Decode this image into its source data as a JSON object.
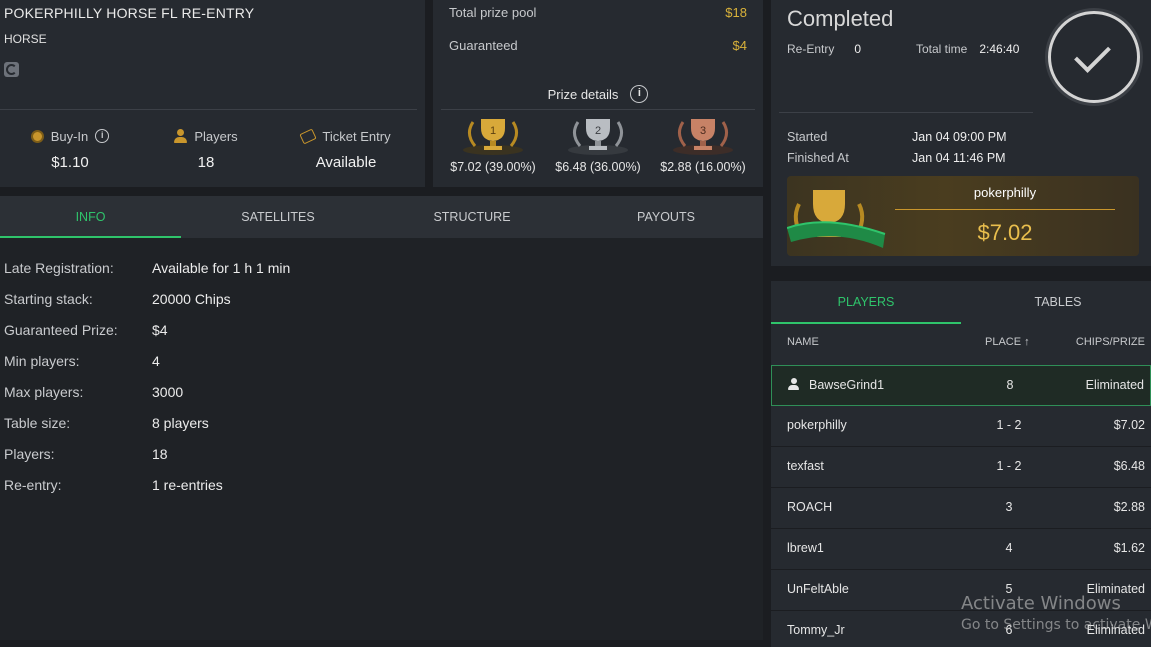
{
  "tournament": {
    "name": "POKERPHILLY HORSE FL RE-ENTRY",
    "game": "HORSE",
    "stats": [
      {
        "label": "Buy-In",
        "value": "$1.10"
      },
      {
        "label": "Players",
        "value": "18"
      },
      {
        "label": "Ticket Entry",
        "value": "Available"
      }
    ]
  },
  "prize": {
    "pool_label": "Total prize pool",
    "pool_value": "$18",
    "guaranteed_label": "Guaranteed",
    "guaranteed_value": "$4",
    "details_title": "Prize details",
    "places": [
      {
        "rank": "1",
        "amount": "$7.02 (39.00%)"
      },
      {
        "rank": "2",
        "amount": "$6.48 (36.00%)"
      },
      {
        "rank": "3",
        "amount": "$2.88 (16.00%)"
      }
    ]
  },
  "status": {
    "title": "Completed",
    "reentry_label": "Re-Entry",
    "reentry_value": "0",
    "total_time_label": "Total time",
    "total_time_value": "2:46:40",
    "started_label": "Started",
    "started_value": "Jan 04 09:00 PM",
    "finished_label": "Finished At",
    "finished_value": "Jan 04 11:46 PM",
    "winner_name": "pokerphilly",
    "winner_prize": "$7.02"
  },
  "tabs": [
    "INFO",
    "SATELLITES",
    "STRUCTURE",
    "PAYOUTS"
  ],
  "info_rows": [
    {
      "label": "Late Registration:",
      "value": "Available for 1 h 1 min"
    },
    {
      "label": "Starting stack:",
      "value": "20000 Chips"
    },
    {
      "label": "Guaranteed Prize:",
      "value": "$4"
    },
    {
      "label": "Min players:",
      "value": "4"
    },
    {
      "label": "Max players:",
      "value": "3000"
    },
    {
      "label": "Table size:",
      "value": "8 players"
    },
    {
      "label": "Players:",
      "value": "18"
    },
    {
      "label": "Re-entry:",
      "value": "1 re-entries"
    }
  ],
  "players_panel": {
    "tabs": [
      "PLAYERS",
      "TABLES"
    ],
    "columns": [
      "NAME",
      "PLACE ↑",
      "CHIPS/PRIZE"
    ],
    "rows": [
      {
        "name": "BawseGrind1",
        "place": "8",
        "prize": "Eliminated"
      },
      {
        "name": "pokerphilly",
        "place": "1 - 2",
        "prize": "$7.02"
      },
      {
        "name": "texfast",
        "place": "1 - 2",
        "prize": "$6.48"
      },
      {
        "name": "ROACH",
        "place": "3",
        "prize": "$2.88"
      },
      {
        "name": "lbrew1",
        "place": "4",
        "prize": "$1.62"
      },
      {
        "name": "UnFeltAble",
        "place": "5",
        "prize": "Eliminated"
      },
      {
        "name": "Tommy_Jr",
        "place": "6",
        "prize": "Eliminated"
      }
    ]
  },
  "watermark": {
    "line1": "Activate Windows",
    "line2": "Go to Settings to activate Wi"
  },
  "colors": {
    "accent_green": "#2fc46b",
    "gold": "#d9b23a",
    "panel": "#262a30",
    "background": "#1b1d21"
  }
}
